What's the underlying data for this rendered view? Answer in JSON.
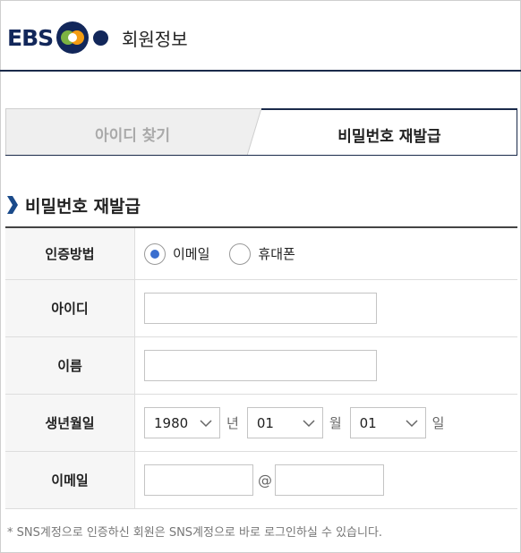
{
  "header": {
    "logo_text": "EBS",
    "logo_colors": {
      "navy": "#12275a",
      "green": "#7cb342",
      "orange": "#f39c12",
      "blue": "#1565c0"
    },
    "title": "회원정보"
  },
  "tabs": [
    {
      "label": "아이디 찾기",
      "active": false
    },
    {
      "label": "비밀번호 재발급",
      "active": true
    }
  ],
  "section": {
    "title": "비밀번호 재발급",
    "icon": "chevron-right-icon"
  },
  "form": {
    "method": {
      "label": "인증방법",
      "options": [
        {
          "label": "이메일",
          "selected": true
        },
        {
          "label": "휴대폰",
          "selected": false
        }
      ]
    },
    "id": {
      "label": "아이디",
      "value": ""
    },
    "name": {
      "label": "이름",
      "value": ""
    },
    "birth": {
      "label": "생년월일",
      "year": "1980",
      "year_unit": "년",
      "month": "01",
      "month_unit": "월",
      "day": "01",
      "day_unit": "일"
    },
    "email": {
      "label": "이메일",
      "local": "",
      "at": "@",
      "domain": ""
    }
  },
  "note": "* SNS계정으로 인증하신 회원은 SNS계정으로 바로 로그인하실 수 있습니다.",
  "colors": {
    "accent": "#1a2a4a",
    "radio_on": "#3a6ecf"
  }
}
